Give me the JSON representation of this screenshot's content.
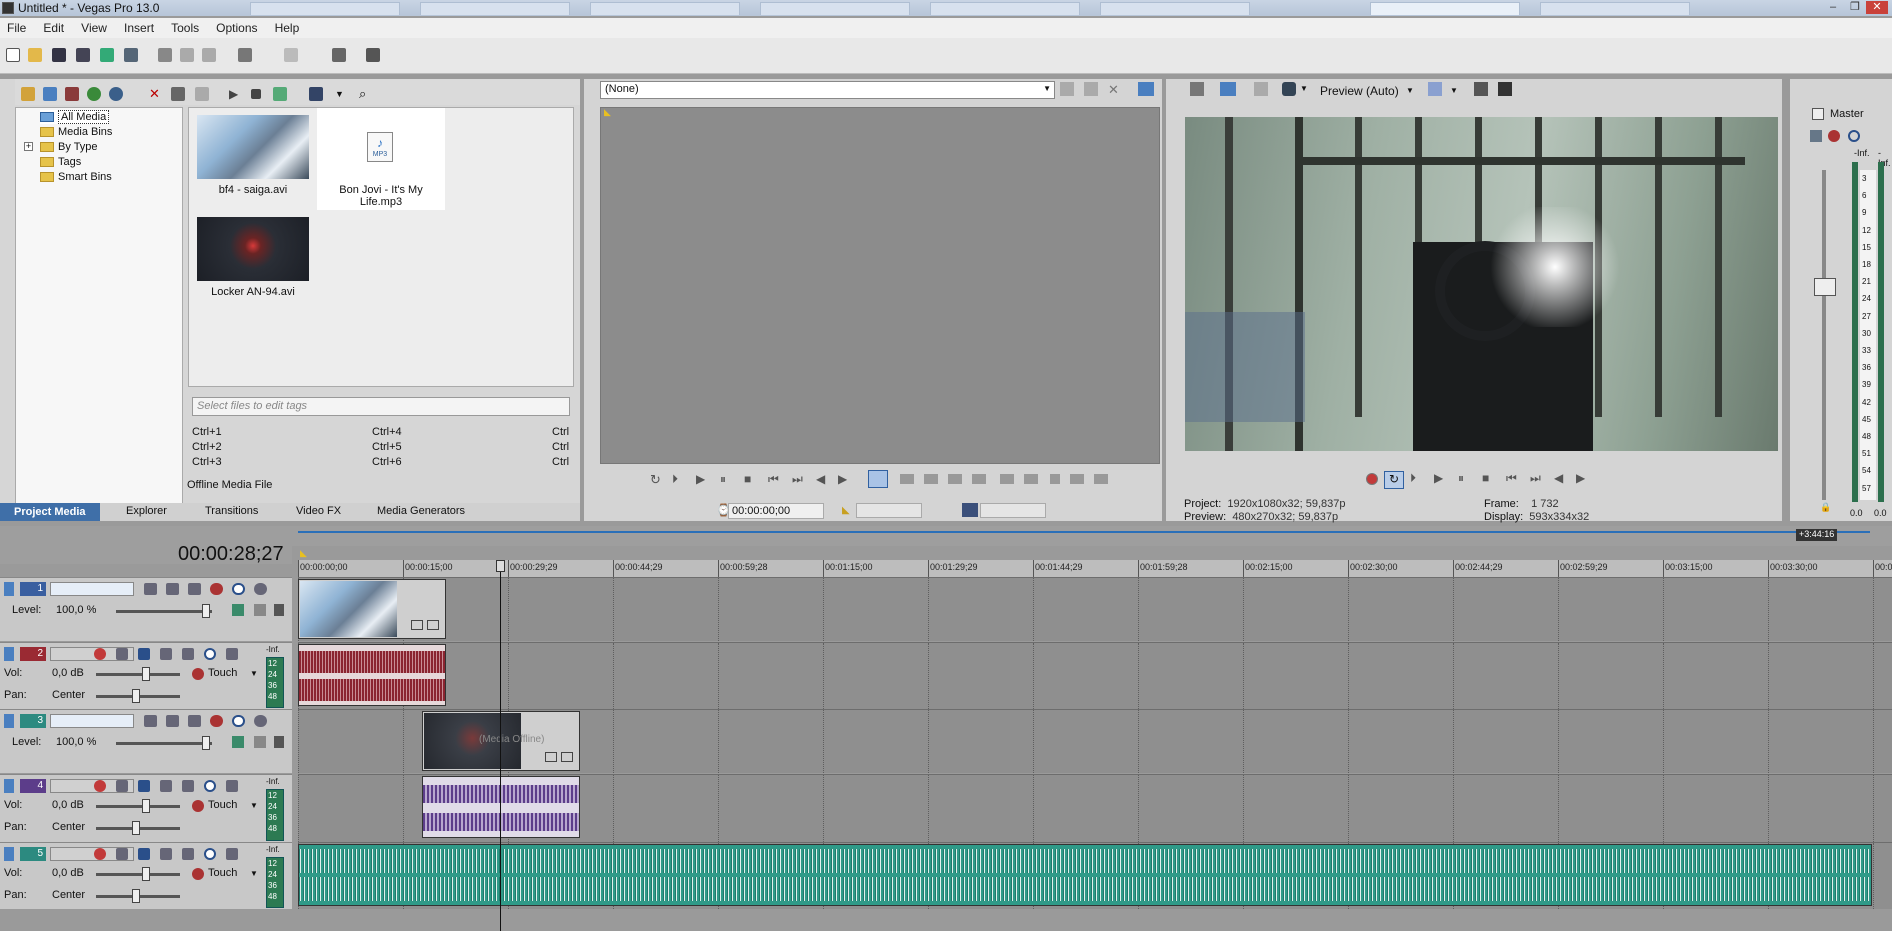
{
  "window": {
    "title": "Untitled * - Vegas Pro 13.0"
  },
  "menu": [
    "File",
    "Edit",
    "View",
    "Insert",
    "Tools",
    "Options",
    "Help"
  ],
  "media_tree": {
    "items": [
      {
        "label": "All Media"
      },
      {
        "label": "Media Bins"
      },
      {
        "label": "By Type"
      },
      {
        "label": "Tags"
      },
      {
        "label": "Smart Bins"
      }
    ]
  },
  "media_files": [
    {
      "name": "bf4 - saiga.avi"
    },
    {
      "name": "Bon Jovi - It's My Life.mp3",
      "badge": "MP3"
    },
    {
      "name": "Locker AN-94.avi"
    }
  ],
  "tags": {
    "placeholder": "Select files to edit tags",
    "shortcuts": [
      "Ctrl+1",
      "Ctrl+2",
      "Ctrl+3",
      "Ctrl+4",
      "Ctrl+5",
      "Ctrl+6",
      "Ctrl",
      "Ctrl",
      "Ctrl"
    ]
  },
  "media_status": "Offline Media File",
  "tabs": [
    "Project Media",
    "Explorer",
    "Transitions",
    "Video FX",
    "Media Generators"
  ],
  "trimmer": {
    "selection": "(None)",
    "timecode": "00:00:00;00"
  },
  "preview": {
    "mode": "Preview (Auto)",
    "project_label": "Project:",
    "project_value": "1920x1080x32; 59,837p",
    "preview_label": "Preview:",
    "preview_value": "480x270x32; 59,837p",
    "frame_label": "Frame:",
    "frame_value": "1 732",
    "display_label": "Display:",
    "display_value": "593x334x32"
  },
  "master": {
    "title": "Master",
    "inf_left": "-Inf.",
    "inf_right": "-Inf.",
    "scale": [
      "3",
      "6",
      "9",
      "12",
      "15",
      "18",
      "21",
      "24",
      "27",
      "30",
      "33",
      "36",
      "39",
      "42",
      "45",
      "48",
      "51",
      "54",
      "57"
    ],
    "bottom_left": "0.0",
    "bottom_right": "0.0"
  },
  "timeline": {
    "timecode": "00:00:28;27",
    "end_marker": "+3:44:16",
    "ruler": [
      "00:00:00;00",
      "00:00:15;00",
      "00:00:29;29",
      "00:00:44;29",
      "00:00:59;28",
      "00:01:15;00",
      "00:01:29;29",
      "00:01:44;29",
      "00:01:59;28",
      "00:02:15;00",
      "00:02:30;00",
      "00:02:44;29",
      "00:02:59;29",
      "00:03:15;00",
      "00:03:30;00",
      "00:0"
    ],
    "tracks": [
      {
        "num": "1",
        "type": "video",
        "level_label": "Level:",
        "level": "100,0 %",
        "color": "#3a5fa0"
      },
      {
        "num": "2",
        "type": "audio",
        "vol_label": "Vol:",
        "vol": "0,0 dB",
        "pan_label": "Pan:",
        "pan": "Center",
        "mode": "Touch",
        "color": "#9a2a33",
        "meter_top": "-Inf.",
        "meter": [
          "12",
          "24",
          "36",
          "48"
        ]
      },
      {
        "num": "3",
        "type": "video",
        "level_label": "Level:",
        "level": "100,0 %",
        "color": "#2c8a80"
      },
      {
        "num": "4",
        "type": "audio",
        "vol_label": "Vol:",
        "vol": "0,0 dB",
        "pan_label": "Pan:",
        "pan": "Center",
        "mode": "Touch",
        "color": "#5c3d8a",
        "meter_top": "-Inf.",
        "meter": [
          "12",
          "24",
          "36",
          "48"
        ]
      },
      {
        "num": "5",
        "type": "audio",
        "vol_label": "Vol:",
        "vol": "0,0 dB",
        "pan_label": "Pan:",
        "pan": "Center",
        "mode": "Touch",
        "color": "#2c8a80",
        "meter_top": "-Inf.",
        "meter": [
          "12",
          "24",
          "36",
          "48"
        ]
      }
    ],
    "offline_clip_text": "(Media Offline)"
  }
}
